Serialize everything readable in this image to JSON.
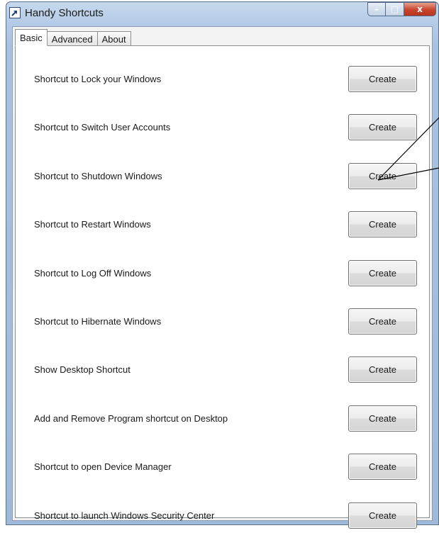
{
  "window": {
    "title": "Handy Shortcuts",
    "icon": "shortcut-arrow-icon",
    "controls": {
      "minimize": "–",
      "maximize": "□",
      "close": "x"
    }
  },
  "tabs": [
    {
      "label": "Basic",
      "active": true
    },
    {
      "label": "Advanced",
      "active": false
    },
    {
      "label": "About",
      "active": false
    }
  ],
  "shortcuts": [
    {
      "label": "Shortcut to Lock your Windows",
      "button": "Create"
    },
    {
      "label": "Shortcut to Switch User Accounts",
      "button": "Create"
    },
    {
      "label": "Shortcut to Shutdown Windows",
      "button": "Create"
    },
    {
      "label": "Shortcut to Restart Windows",
      "button": "Create"
    },
    {
      "label": "Shortcut to Log Off Windows",
      "button": "Create"
    },
    {
      "label": "Shortcut to Hibernate Windows",
      "button": "Create"
    },
    {
      "label": "Show Desktop Shortcut",
      "button": "Create"
    },
    {
      "label": "Add and Remove Program shortcut on Desktop",
      "button": "Create"
    },
    {
      "label": "Shortcut to open Device Manager",
      "button": "Create"
    },
    {
      "label": "Shortcut to launch Windows Security Center",
      "button": "Create"
    }
  ],
  "colors": {
    "title_bar": "#b4cbe6",
    "close_button": "#c7442d",
    "panel_background": "#ffffff"
  }
}
